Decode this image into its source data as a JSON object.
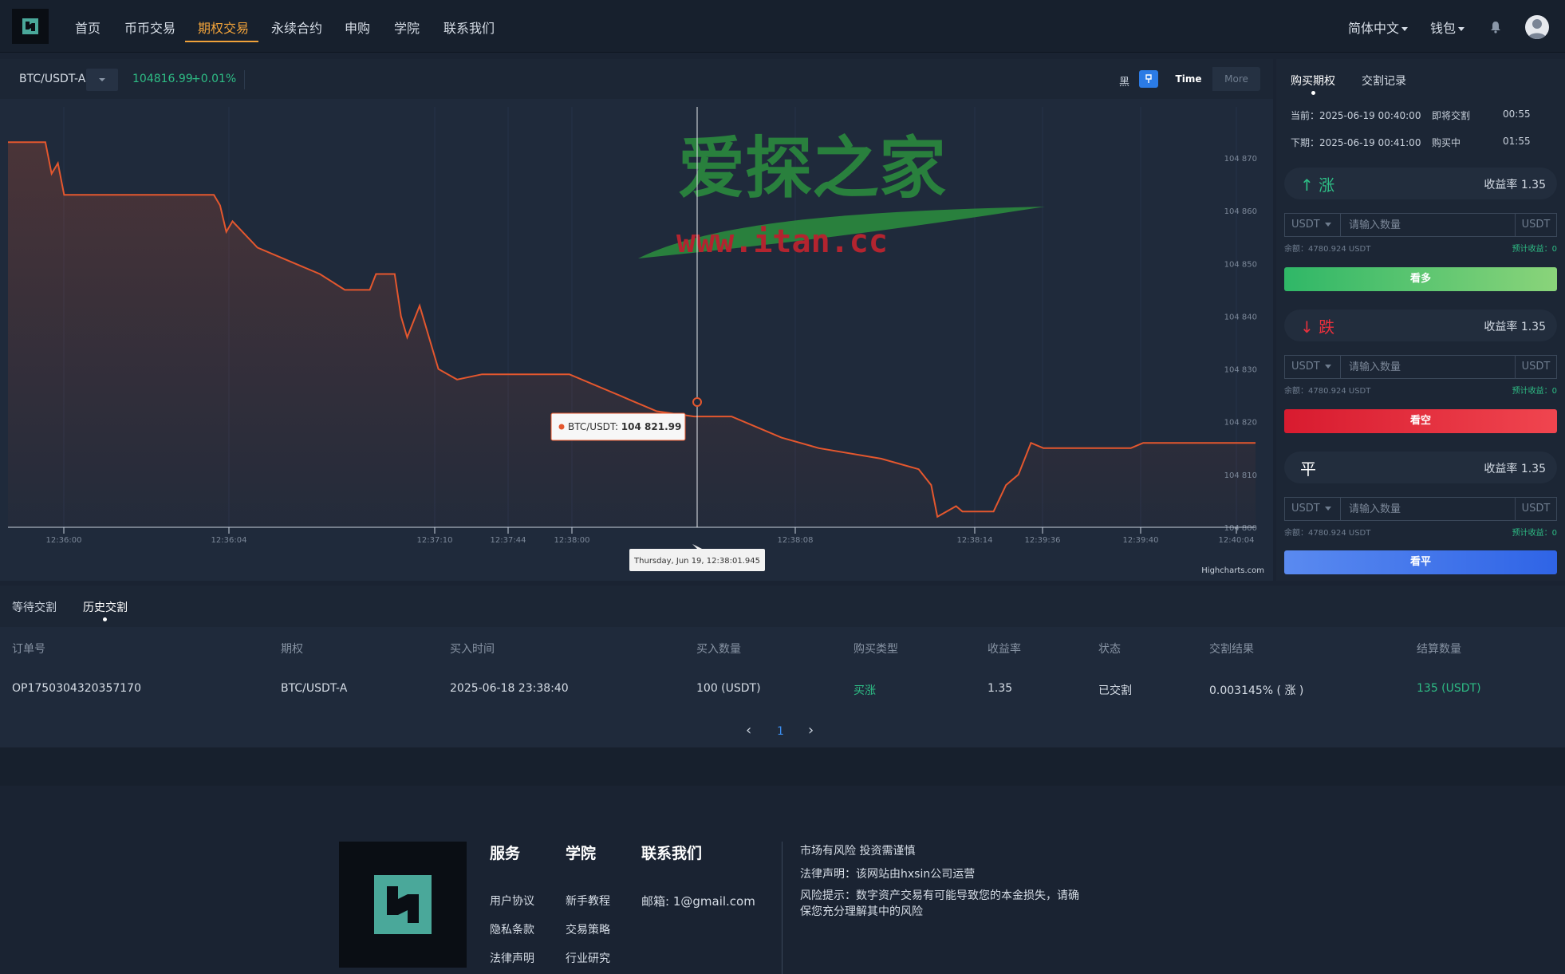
{
  "nav": {
    "items": [
      "首页",
      "币币交易",
      "期权交易",
      "永续合约",
      "申购",
      "学院",
      "联系我们"
    ],
    "active_index": 2,
    "language": "简体中文",
    "wallet": "钱包"
  },
  "chart_toolbar": {
    "pair": "BTC/USDT-A",
    "price": "104816.99",
    "change": "+0.01%",
    "theme_label": "黑",
    "time_label": "Time",
    "more_label": "More"
  },
  "watermark": {
    "title": "爱探之家",
    "url": "www.itan.cc"
  },
  "chart_data": {
    "type": "line",
    "series": [
      {
        "name": "BTC/USDT",
        "points": [
          [
            0,
            104873
          ],
          [
            0.03,
            104873
          ],
          [
            0.035,
            104867
          ],
          [
            0.04,
            104869
          ],
          [
            0.045,
            104863
          ],
          [
            0.13,
            104863
          ],
          [
            0.165,
            104863
          ],
          [
            0.17,
            104861
          ],
          [
            0.175,
            104856
          ],
          [
            0.18,
            104858
          ],
          [
            0.2,
            104853
          ],
          [
            0.22,
            104851
          ],
          [
            0.25,
            104848
          ],
          [
            0.27,
            104845
          ],
          [
            0.29,
            104845
          ],
          [
            0.295,
            104848
          ],
          [
            0.31,
            104848
          ],
          [
            0.315,
            104840
          ],
          [
            0.32,
            104836
          ],
          [
            0.33,
            104842
          ],
          [
            0.345,
            104830
          ],
          [
            0.36,
            104828
          ],
          [
            0.38,
            104829
          ],
          [
            0.45,
            104829
          ],
          [
            0.47,
            104827
          ],
          [
            0.49,
            104825
          ],
          [
            0.5,
            104824
          ],
          [
            0.52,
            104822
          ],
          [
            0.55,
            104821
          ],
          [
            0.58,
            104821
          ],
          [
            0.6,
            104819
          ],
          [
            0.62,
            104817
          ],
          [
            0.65,
            104815
          ],
          [
            0.7,
            104813
          ],
          [
            0.73,
            104811
          ],
          [
            0.74,
            104808
          ],
          [
            0.745,
            104802
          ],
          [
            0.76,
            104804
          ],
          [
            0.765,
            104803
          ],
          [
            0.79,
            104803
          ],
          [
            0.8,
            104808
          ],
          [
            0.81,
            104810
          ],
          [
            0.815,
            104813
          ],
          [
            0.82,
            104816
          ],
          [
            0.83,
            104815
          ],
          [
            0.9,
            104815
          ],
          [
            0.91,
            104816
          ],
          [
            1.0,
            104816
          ]
        ]
      }
    ],
    "x_ticks": [
      "12:36:00",
      "12:36:04",
      "12:37:10",
      "12:37:44",
      "12:38:00",
      "12:38:08",
      "12:38:14",
      "12:39:36",
      "12:39:40",
      "12:40:04"
    ],
    "y_ticks": [
      "104 870",
      "104 860",
      "104 850",
      "104 840",
      "104 830",
      "104 820",
      "104 810",
      "104 800"
    ],
    "ylim": [
      104800,
      104875
    ],
    "tooltip_series": "BTC/USDT",
    "tooltip_value": "104 821.99",
    "tooltip_date": "Thursday, Jun 19, 12:38:01.945",
    "credits": "Highcharts.com"
  },
  "side": {
    "tabs": [
      "购买期权",
      "交割记录"
    ],
    "current_label": "当前：2025-06-19 00:40:00",
    "current_status": "即将交割",
    "current_time": "00:55",
    "next_label": "下期：2025-06-19 00:41:00",
    "next_status": "购买中",
    "next_time": "01:55",
    "up": {
      "label": "涨",
      "arrow": "↑",
      "rate": "收益率 1.35",
      "action": "看多"
    },
    "down": {
      "label": "跌",
      "arrow": "↓",
      "rate": "收益率 1.35",
      "action": "看空"
    },
    "flat": {
      "label": "平",
      "rate": "收益率 1.35",
      "action": "看平"
    },
    "unit": "USDT",
    "qty_placeholder": "请输入数量",
    "balance": "余额：4780.924 USDT",
    "estimate": "预计收益：0",
    "colors": {
      "up": "#2ebd85",
      "down": "#e8303d",
      "flat_btn": "#3b6fe8"
    }
  },
  "orders": {
    "tabs": [
      "等待交割",
      "历史交割"
    ],
    "columns": [
      "订单号",
      "期权",
      "买入时间",
      "买入数量",
      "购买类型",
      "收益率",
      "状态",
      "交割结果",
      "结算数量"
    ],
    "rows": [
      [
        "OP1750304320357170",
        "BTC/USDT-A",
        "2025-06-18 23:38:40",
        "100 (USDT)",
        "买涨",
        "1.35",
        "已交割",
        "0.003145% ( 涨 )",
        "135 (USDT)"
      ]
    ],
    "pager": {
      "prev": "‹",
      "page": "1",
      "next": "›"
    }
  },
  "footer": {
    "services_title": "服务",
    "academy_title": "学院",
    "contact_title": "联系我们",
    "services": [
      "用户协议",
      "隐私条款",
      "法律声明"
    ],
    "academy": [
      "新手教程",
      "交易策略",
      "行业研究"
    ],
    "email": "邮箱: 1@gmail.com",
    "risk": "市场有风险 投资需谨慎",
    "legal": "法律声明：该网站由hxsin公司运营",
    "warning": "风险提示：数字资产交易有可能导致您的本金损失，请确保您充分理解其中的风险"
  }
}
